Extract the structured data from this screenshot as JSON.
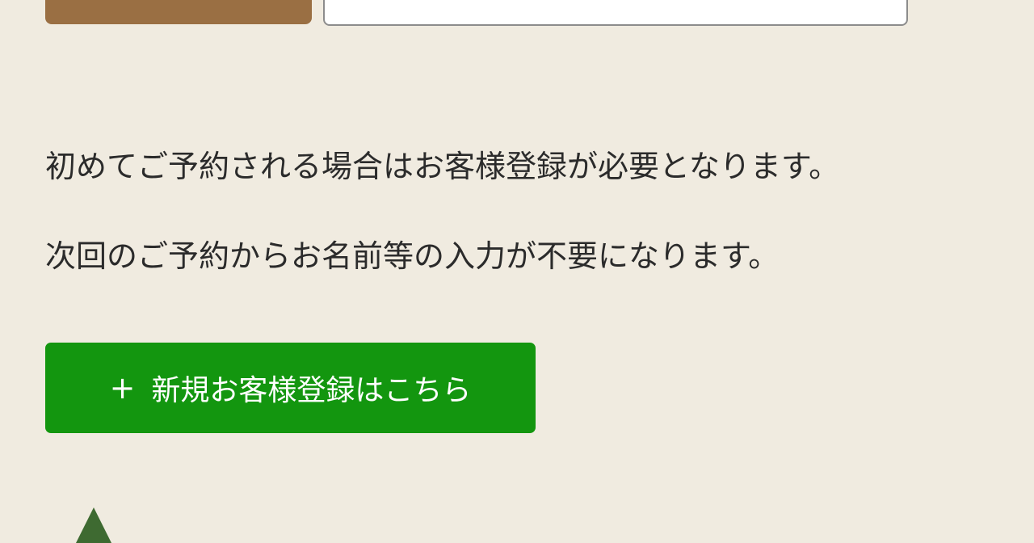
{
  "notice": {
    "line1": "初めてご予約される場合はお客様登録が必要となります。",
    "line2": "次回のご予約からお名前等の入力が不要になります。"
  },
  "register_button": {
    "icon": "+",
    "label": "新規お客様登録はこちら",
    "color": "#13960f"
  },
  "colors": {
    "background": "#f0ebe0",
    "top_button": "#9a6f43",
    "tree_icon": "#3e6a31"
  },
  "icons": {
    "bottom": "tree-icon"
  }
}
